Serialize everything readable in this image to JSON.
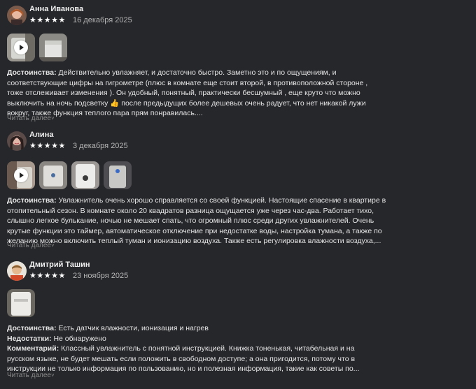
{
  "reviews": [
    {
      "name": "Анна Иванова",
      "stars": "★★★★★",
      "date": "16 декабря 2025",
      "lines": [
        {
          "label": "Достоинства:",
          "text": " Действительно увлажняет, и достаточно быстро. Заметно это и по ощущениям, и"
        },
        {
          "label": "",
          "text": "соответствующие цифры на гигрометре (плюс в комнате еще стоит второй, в противоположной стороне ,"
        },
        {
          "label": "",
          "text": "тоже отслеживает изменения ). Он удобный, понятный, практически бесшумный , еще круто что можно"
        },
        {
          "label": "",
          "text": "выключить на ночь подсветку 👍 после предыдущих более дешевых очень радует, что нет никакой лужи"
        },
        {
          "label": "",
          "text": "вокруг, также функция теплого пара прям понравилась...."
        }
      ],
      "read_more": "Читать далее"
    },
    {
      "name": "Алина",
      "stars": "★★★★★",
      "date": "3 декабря 2025",
      "lines": [
        {
          "label": "Достоинства:",
          "text": " Увлажнитель очень хорошо справляется со своей функцией. Настоящие спасение в квартире в"
        },
        {
          "label": "",
          "text": "отопительный сезон. В комнате около 20 квадратов разница ощущается уже через час-два. Работает тихо,"
        },
        {
          "label": "",
          "text": "слышно легкое булькание, ночью не мешает спать, что огромный плюс среди других увлажнителей. Очень"
        },
        {
          "label": "",
          "text": "крутые функции это таймер, автоматическое отключение при недостатке воды, настройка тумана, а также по"
        },
        {
          "label": "",
          "text": "желанию можно включить теплый туман и ионизацию воздуха. Также есть регулировка влажности воздуха,..."
        }
      ],
      "read_more": "Читать далее"
    },
    {
      "name": "Дмитрий Ташин",
      "stars": "★★★★★",
      "date": "23 ноября 2025",
      "lines": [
        {
          "label": "Достоинства:",
          "text": " Есть датчик влажности, ионизация и нагрев"
        },
        {
          "label": "Недостатки:",
          "text": " Не обнаружено"
        },
        {
          "label": "Комментарий:",
          "text": " Классный увлажнитель с понятной инструкцией. Книжка тоненькая, читабельная и на"
        },
        {
          "label": "",
          "text": "русском языке, не будет мешать если положить в свободном доступе; а она пригодится, потому что в"
        },
        {
          "label": "",
          "text": "инструкции не только информация по пользованию, но и полезная информация, такие как советы по..."
        }
      ],
      "read_more": "Читать далее"
    }
  ],
  "icons": {
    "star": "star-icon",
    "play": "play-icon",
    "chevron": "chevron-down-icon"
  }
}
